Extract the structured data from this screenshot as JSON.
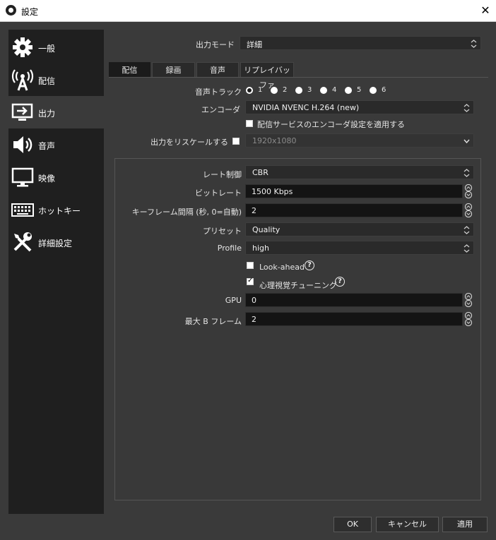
{
  "window": {
    "title": "設定",
    "close_glyph": "✕"
  },
  "sidebar": {
    "items": [
      {
        "label": "一般",
        "icon": "gear-icon"
      },
      {
        "label": "配信",
        "icon": "broadcast-antenna-icon"
      },
      {
        "label": "出力",
        "icon": "output-monitor-icon",
        "active": true
      },
      {
        "label": "音声",
        "icon": "speaker-icon"
      },
      {
        "label": "映像",
        "icon": "monitor-icon"
      },
      {
        "label": "ホットキー",
        "icon": "keyboard-icon"
      },
      {
        "label": "詳細設定",
        "icon": "tools-icon"
      }
    ]
  },
  "output_mode": {
    "label": "出力モード",
    "value": "詳細"
  },
  "tabs": [
    {
      "label": "配信",
      "active": true
    },
    {
      "label": "録画"
    },
    {
      "label": "音声"
    },
    {
      "label": "リプレイバッファ"
    }
  ],
  "audio_track": {
    "label": "音声トラック",
    "options": [
      "1",
      "2",
      "3",
      "4",
      "5",
      "6"
    ],
    "selected": "1"
  },
  "encoder": {
    "label": "エンコーダ",
    "value": "NVIDIA NVENC H.264 (new)"
  },
  "apply_service_encoder": {
    "label": "配信サービスのエンコーダ設定を適用する",
    "checked": false
  },
  "rescale": {
    "label": "出力をリスケールする",
    "checked": false,
    "value": "1920x1080"
  },
  "settings": {
    "rate_control": {
      "label": "レート制御",
      "value": "CBR"
    },
    "bitrate": {
      "label": "ビットレート",
      "value": "1500 Kbps"
    },
    "keyframe": {
      "label": "キーフレーム間隔 (秒, 0=自動)",
      "value": "2"
    },
    "preset": {
      "label": "プリセット",
      "value": "Quality"
    },
    "profile": {
      "label": "Profile",
      "value": "high"
    },
    "lookahead": {
      "label": "Look-ahead",
      "checked": false
    },
    "psycho_visual": {
      "label": "心理視覚チューニング",
      "checked": true
    },
    "gpu": {
      "label": "GPU",
      "value": "0"
    },
    "max_bframes": {
      "label": "最大 B フレーム",
      "value": "2"
    }
  },
  "buttons": {
    "ok": "OK",
    "cancel": "キャンセル",
    "apply": "適用"
  },
  "colors": {
    "background": "#3a3a3a",
    "sidebar": "#1f1f1f",
    "input": "#2a2a2a",
    "spin_input": "#141414",
    "active_tab": "#1b1b1b"
  }
}
